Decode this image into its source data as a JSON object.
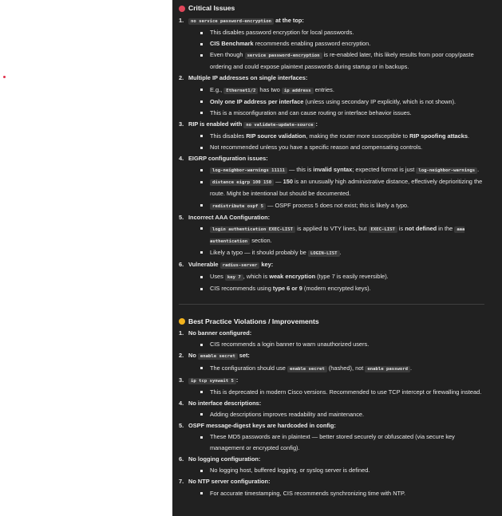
{
  "sections": {
    "critical": {
      "title": "Critical Issues",
      "items": [
        {
          "num": "1.",
          "head": [
            {
              "c": "no service password-encryption"
            },
            {
              "b": " at the top:"
            }
          ],
          "bullets": [
            [
              {
                "t": "This disables password encryption for local passwords."
              }
            ],
            [
              {
                "b": "CIS Benchmark"
              },
              {
                "t": " recommends enabling password encryption."
              }
            ],
            [
              {
                "t": "Even though "
              },
              {
                "c": "service password-encryption"
              },
              {
                "t": " is re-enabled later, this likely results from poor copy/paste ordering and could expose plaintext passwords during startup or in backups."
              }
            ]
          ]
        },
        {
          "num": "2.",
          "head": [
            {
              "b": "Multiple IP addresses on single interfaces:"
            }
          ],
          "bullets": [
            [
              {
                "t": "E.g., "
              },
              {
                "c": "Ethernet1/2"
              },
              {
                "t": " has two "
              },
              {
                "c": "ip address"
              },
              {
                "t": " entries."
              }
            ],
            [
              {
                "b": "Only one IP address per interface"
              },
              {
                "t": " (unless using secondary IP explicitly, which is not shown)."
              }
            ],
            [
              {
                "t": "This is a misconfiguration and can cause routing or interface behavior issues."
              }
            ]
          ]
        },
        {
          "num": "3.",
          "head": [
            {
              "b": "RIP is enabled with "
            },
            {
              "c": "no validate-update-source"
            },
            {
              "b": ":"
            }
          ],
          "bullets": [
            [
              {
                "t": "This disables "
              },
              {
                "b": "RIP source validation"
              },
              {
                "t": ", making the router more susceptible to "
              },
              {
                "b": "RIP spoofing attacks"
              },
              {
                "t": "."
              }
            ],
            [
              {
                "t": "Not recommended unless you have a specific reason and compensating controls."
              }
            ]
          ]
        },
        {
          "num": "4.",
          "head": [
            {
              "b": "EIGRP configuration issues:"
            }
          ],
          "bullets": [
            [
              {
                "c": "log-neighbor-warnings 11111"
              },
              {
                "t": " — this is "
              },
              {
                "b": "invalid syntax"
              },
              {
                "t": "; expected format is just "
              },
              {
                "c": "log-neighbor-warnings"
              },
              {
                "t": "."
              }
            ],
            [
              {
                "c": "distance eigrp 100 150"
              },
              {
                "t": " — "
              },
              {
                "b": "150"
              },
              {
                "t": " is an unusually high administrative distance, effectively deprioritizing the route. Might be intentional but should be documented."
              }
            ],
            [
              {
                "c": "redistribute ospf 5"
              },
              {
                "t": " — OSPF process 5 does not exist; this is likely a typo."
              }
            ]
          ]
        },
        {
          "num": "5.",
          "head": [
            {
              "b": "Incorrect AAA Configuration:"
            }
          ],
          "bullets": [
            [
              {
                "c": "login authentication EXEC-LIST"
              },
              {
                "t": " is applied to VTY lines, but "
              },
              {
                "c": "EXEC-LIST"
              },
              {
                "t": " is "
              },
              {
                "b": "not defined"
              },
              {
                "t": " in the "
              },
              {
                "c": "aaa authentication"
              },
              {
                "t": " section."
              }
            ],
            [
              {
                "t": "Likely a typo — it should probably be "
              },
              {
                "c": "LOGIN-LIST"
              },
              {
                "t": "."
              }
            ]
          ]
        },
        {
          "num": "6.",
          "head": [
            {
              "b": "Vulnerable "
            },
            {
              "c": "radius-server"
            },
            {
              "b": " key:"
            }
          ],
          "bullets": [
            [
              {
                "t": "Uses "
              },
              {
                "c": "key 7"
              },
              {
                "t": ", which is "
              },
              {
                "b": "weak encryption"
              },
              {
                "t": " (type 7 is easily reversible)."
              }
            ],
            [
              {
                "t": "CIS recommends using "
              },
              {
                "b": "type 6 or 9"
              },
              {
                "t": " (modern encrypted keys)."
              }
            ]
          ]
        }
      ]
    },
    "best_practice": {
      "title": "Best Practice Violations / Improvements",
      "items": [
        {
          "num": "1.",
          "head": [
            {
              "b": "No banner configured:"
            }
          ],
          "bullets": [
            [
              {
                "t": "CIS recommends a login banner to warn unauthorized users."
              }
            ]
          ]
        },
        {
          "num": "2.",
          "head": [
            {
              "b": "No "
            },
            {
              "c": "enable secret"
            },
            {
              "b": " set:"
            }
          ],
          "bullets": [
            [
              {
                "t": "The configuration should use "
              },
              {
                "c": "enable secret"
              },
              {
                "t": " (hashed), not "
              },
              {
                "c": "enable password"
              },
              {
                "t": "."
              }
            ]
          ]
        },
        {
          "num": "3.",
          "head": [
            {
              "c": "ip tcp synwait 5"
            },
            {
              "b": ":"
            }
          ],
          "bullets": [
            [
              {
                "t": "This is deprecated in modern Cisco versions. Recommended to use TCP intercept or firewalling instead."
              }
            ]
          ]
        },
        {
          "num": "4.",
          "head": [
            {
              "b": "No interface descriptions:"
            }
          ],
          "bullets": [
            [
              {
                "t": "Adding descriptions improves readability and maintenance."
              }
            ]
          ]
        },
        {
          "num": "5.",
          "head": [
            {
              "b": "OSPF message-digest keys are hardcoded in config:"
            }
          ],
          "bullets": [
            [
              {
                "t": "These MD5 passwords are in plaintext — better stored securely or obfuscated (via secure key management or encrypted config)."
              }
            ]
          ]
        },
        {
          "num": "6.",
          "head": [
            {
              "b": "No logging configuration:"
            }
          ],
          "bullets": [
            [
              {
                "t": "No logging host, buffered logging, or syslog server is defined."
              }
            ]
          ]
        },
        {
          "num": "7.",
          "head": [
            {
              "b": "No NTP server configuration:"
            }
          ],
          "bullets": [
            [
              {
                "t": "For accurate timestamping, CIS recommends synchronizing time with NTP."
              }
            ]
          ]
        }
      ]
    }
  },
  "icons": {
    "critical": "red-circle-icon",
    "best_practice": "yellow-circle-icon"
  },
  "colors": {
    "panel_bg": "#212121",
    "code_bg": "#3a3a3a",
    "red": "#e0465a",
    "yellow": "#f1b21d"
  }
}
